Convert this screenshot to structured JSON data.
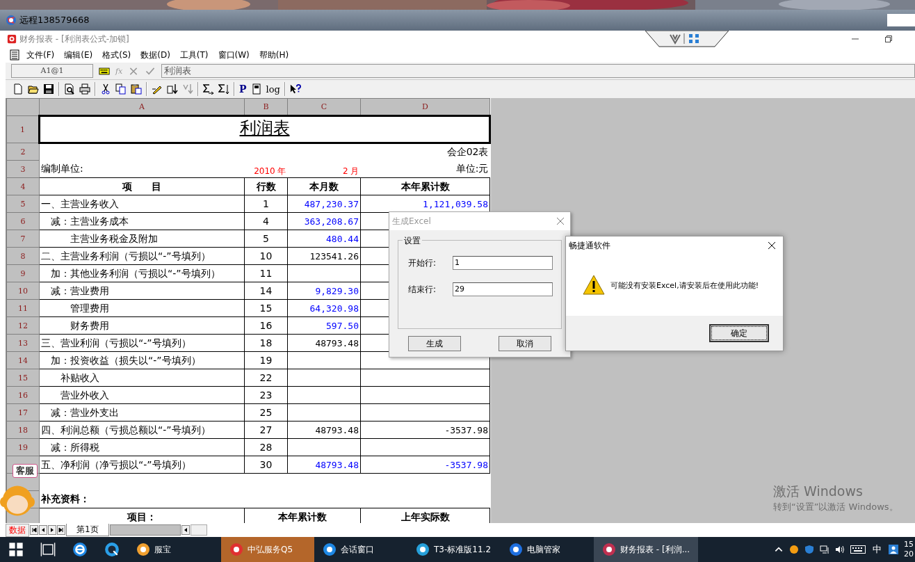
{
  "remote_window": {
    "title": "远程138579668"
  },
  "app_window": {
    "title": "财务报表 - [利润表公式-加锁]"
  },
  "menu": [
    {
      "label": "文件(F)"
    },
    {
      "label": "编辑(E)"
    },
    {
      "label": "格式(S)"
    },
    {
      "label": "数据(D)"
    },
    {
      "label": "工具(T)"
    },
    {
      "label": "窗口(W)"
    },
    {
      "label": "帮助(H)"
    }
  ],
  "formula_bar": {
    "cell_ref": "A1@1",
    "fx": "fx",
    "value": "利润表"
  },
  "toolbar_text": [
    "P",
    "log"
  ],
  "sheet": {
    "columns": [
      "A",
      "B",
      "C",
      "D"
    ],
    "rows": [
      {
        "kind": "title",
        "row_no": "1",
        "title": "利润表"
      },
      {
        "kind": "info",
        "row_no": "2",
        "form_code": "会企02表"
      },
      {
        "kind": "period",
        "row_no": "3",
        "company": "编制单位:",
        "year": "2010 年",
        "month": "2 月",
        "unit": "单位:元"
      },
      {
        "kind": "header",
        "row_no": "4",
        "cells": [
          "项　　目",
          "行数",
          "本月数",
          "本年累计数"
        ]
      },
      {
        "kind": "item",
        "row_no": "5",
        "item": "一、主营业务收入",
        "line": "1",
        "month": {
          "text": "487,230.37",
          "color": "#0000ff"
        },
        "ytd": {
          "text": "1,121,039.58",
          "color": "#0000ff"
        }
      },
      {
        "kind": "item",
        "row_no": "6",
        "item": "　减：主营业务成本",
        "line": "4",
        "month": {
          "text": "363,208.67",
          "color": "#0000ff"
        }
      },
      {
        "kind": "item",
        "row_no": "7",
        "item": "　　　主营业务税金及附加",
        "line": "5",
        "month": {
          "text": "480.44",
          "color": "#0000ff"
        }
      },
      {
        "kind": "item",
        "row_no": "8",
        "item": "二、主营业务利润（亏损以“-”号填列）",
        "line": "10",
        "month": {
          "text": "123541.26",
          "color": "#000000"
        }
      },
      {
        "kind": "item",
        "row_no": "9",
        "item": "　加：其他业务利润（亏损以“-”号填列）",
        "line": "11"
      },
      {
        "kind": "item",
        "row_no": "10",
        "item": "　减：营业费用",
        "line": "14",
        "month": {
          "text": "9,829.30",
          "color": "#0000ff"
        }
      },
      {
        "kind": "item",
        "row_no": "11",
        "item": "　　　管理费用",
        "line": "15",
        "month": {
          "text": "64,320.98",
          "color": "#0000ff"
        }
      },
      {
        "kind": "item",
        "row_no": "12",
        "item": "　　　财务费用",
        "line": "16",
        "month": {
          "text": "597.50",
          "color": "#0000ff"
        }
      },
      {
        "kind": "item",
        "row_no": "13",
        "item": "三、营业利润（亏损以“-”号填列）",
        "line": "18",
        "month": {
          "text": "48793.48",
          "color": "#000000"
        }
      },
      {
        "kind": "item",
        "row_no": "14",
        "item": "　加：投资收益（损失以“-”号填列）",
        "line": "19"
      },
      {
        "kind": "item",
        "row_no": "15",
        "item": "　　补贴收入",
        "line": "22"
      },
      {
        "kind": "item",
        "row_no": "16",
        "item": "　　营业外收入",
        "line": "23"
      },
      {
        "kind": "item",
        "row_no": "17",
        "item": "　减：营业外支出",
        "line": "25"
      },
      {
        "kind": "item",
        "row_no": "18",
        "item": "四、利润总额（亏损总额以“-”号填列）",
        "line": "27",
        "month": {
          "text": "48793.48",
          "color": "#000000"
        },
        "ytd": {
          "text": "-3537.98",
          "color": "#000000"
        }
      },
      {
        "kind": "item",
        "row_no": "19",
        "item": "　减：所得税",
        "line": "28"
      },
      {
        "kind": "item",
        "item": "五、净利润（净亏损以“-”号填列）",
        "line": "30",
        "month": {
          "text": "48793.48",
          "color": "#0000ff"
        },
        "ytd": {
          "text": "-3537.98",
          "color": "#0000ff"
        }
      },
      {
        "kind": "blank"
      },
      {
        "kind": "section",
        "label": "补充资料："
      },
      {
        "kind": "subheader",
        "cells": [
          "项目：",
          "本年累计数",
          "上年实际数"
        ]
      },
      {
        "kind": "partial"
      }
    ]
  },
  "sheet_tabs": {
    "label": "数据",
    "tabs": [
      {
        "label": "第1页",
        "selected": true
      }
    ]
  },
  "dialog_excel": {
    "title": "生成Excel",
    "group": "设置",
    "fields": [
      {
        "label": "开始行:",
        "value": "1"
      },
      {
        "label": "结束行:",
        "value": "29"
      }
    ],
    "buttons": [
      "生成",
      "取消"
    ]
  },
  "message_box": {
    "title": "畅捷通软件",
    "message": "可能没有安装Excel,请安装后在使用此功能!",
    "button": "确定"
  },
  "support_badge": "客服",
  "activation_notice": {
    "title": "激活 Windows",
    "text": "转到“设置”以激活 Windows。"
  },
  "taskbar": {
    "apps": [
      {
        "label": "服宝",
        "selected": false,
        "flashing": false
      },
      {
        "label": "中弘服务Q5",
        "selected": false,
        "flashing": true
      },
      {
        "label": "会话窗口",
        "selected": false,
        "flashing": false
      },
      {
        "label": "T3-标准版11.2",
        "selected": false,
        "flashing": false
      },
      {
        "label": "电脑管家",
        "selected": false,
        "flashing": false
      },
      {
        "label": "财务报表 - [利润...",
        "selected": true,
        "flashing": false
      }
    ],
    "ime": "中",
    "clock": [
      "15",
      "20"
    ]
  }
}
